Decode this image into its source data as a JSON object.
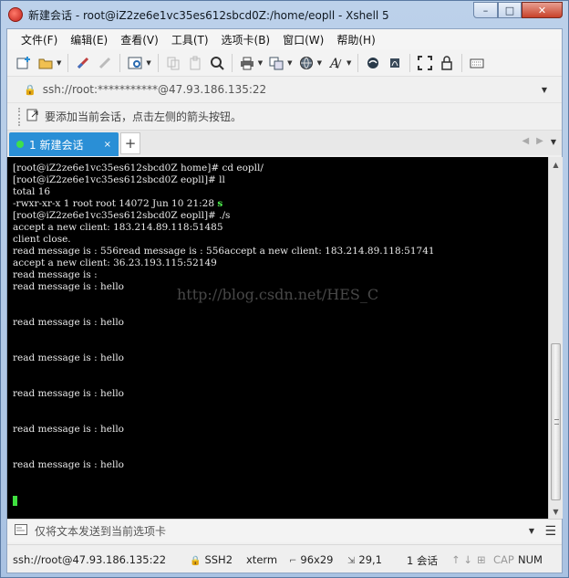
{
  "window": {
    "title": "新建会话 - root@iZ2ze6e1vc35es612sbcd0Z:/home/eopll - Xshell 5",
    "min_glyph": "–",
    "max_glyph": "□",
    "close_glyph": "✕"
  },
  "menu": [
    "文件(F)",
    "编辑(E)",
    "查看(V)",
    "工具(T)",
    "选项卡(B)",
    "窗口(W)",
    "帮助(H)"
  ],
  "address": {
    "lock_glyph": "🔒",
    "text": "ssh://root:***********@47.93.186.135:22"
  },
  "hint": {
    "text": "要添加当前会话，点击左侧的箭头按钮。"
  },
  "tab": {
    "label": "1 新建会话",
    "close": "×",
    "add": "+"
  },
  "terminal": {
    "lines": [
      "[root@iZ2ze6e1vc35es612sbcd0Z home]# cd eopll/",
      "[root@iZ2ze6e1vc35es612sbcd0Z eopll]# ll",
      "total 16",
      "-rwxr-xr-x 1 root root 14072 Jun 10 21:28 ",
      "[root@iZ2ze6e1vc35es612sbcd0Z eopll]# ./s",
      "accept a new client: 183.214.89.118:51485",
      "client close.",
      "read message is : 556read message is : 556accept a new client: 183.214.89.118:51741",
      "accept a new client: 36.23.193.115:52149",
      "read message is :",
      "read message is : hello",
      "",
      "",
      "read message is : hello",
      "",
      "",
      "read message is : hello",
      "",
      "",
      "read message is : hello",
      "",
      "",
      "read message is : hello",
      "",
      "",
      "read message is : hello"
    ],
    "executable_name": "s",
    "watermark": "http://blog.csdn.net/HES_C",
    "accent": "#3fe03f"
  },
  "sendbar": {
    "text": "仅将文本发送到当前选项卡"
  },
  "status": {
    "connection": "ssh://root@47.93.186.135:22",
    "protocol": "SSH2",
    "term": "xterm",
    "size": "96x29",
    "position": "29,1",
    "sessions": "1 会话",
    "caps": "CAP",
    "num": "NUM"
  }
}
